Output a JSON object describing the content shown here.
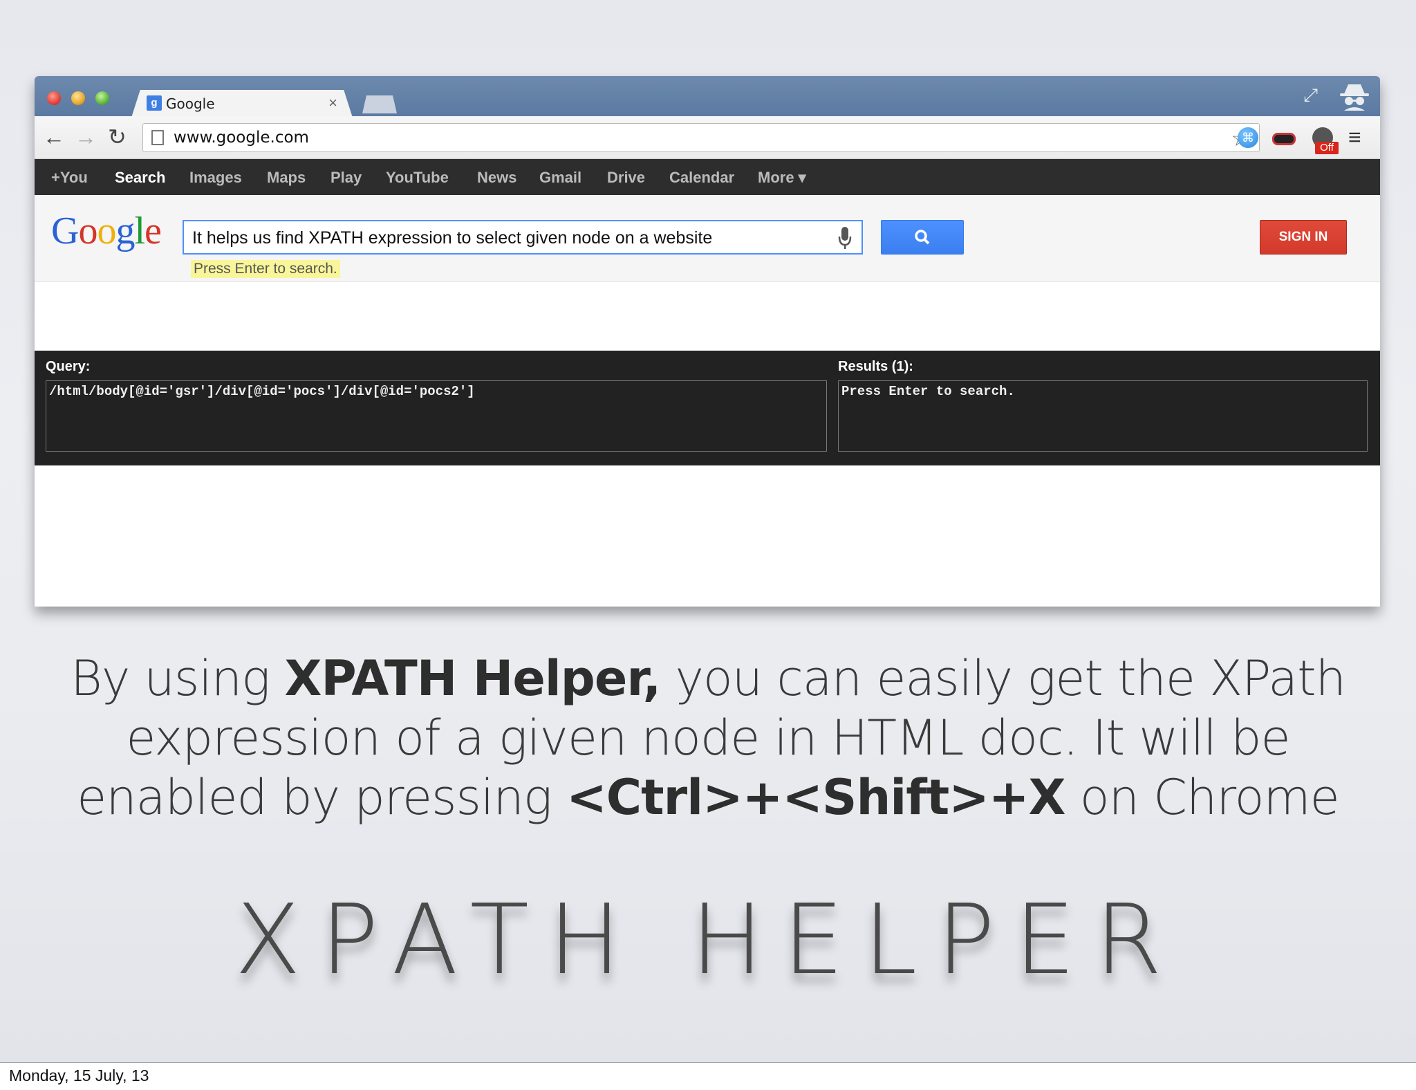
{
  "browser": {
    "tab_title": "Google",
    "tab_close": "×",
    "url": "www.google.com",
    "ext_badge": "Off"
  },
  "google_bar": {
    "items": [
      "+You",
      "Search",
      "Images",
      "Maps",
      "Play",
      "YouTube",
      "News",
      "Gmail",
      "Drive",
      "Calendar",
      "More ▾"
    ],
    "active": "Search"
  },
  "google": {
    "logo": "Google",
    "search_value": "It helps us find XPATH expression to select given node on a website",
    "hint": "Press Enter to search.",
    "sign_in": "SIGN IN"
  },
  "xpath_helper": {
    "query_label": "Query:",
    "query_value": "/html/body[@id='gsr']/div[@id='pocs']/div[@id='pocs2']",
    "results_label": "Results (1):",
    "results_value": "Press Enter to search."
  },
  "slide": {
    "caption": {
      "part1": "By using ",
      "bold1": "XPATH Helper,",
      "part2": " you can easily get the XPath expression of a given node in HTML doc. It will be enabled by pressing ",
      "bold2": "<Ctrl>+<Shift>+X",
      "part3": " on Chrome"
    },
    "title": "XPATH HELPER",
    "date": "Monday, 15 July, 13"
  }
}
